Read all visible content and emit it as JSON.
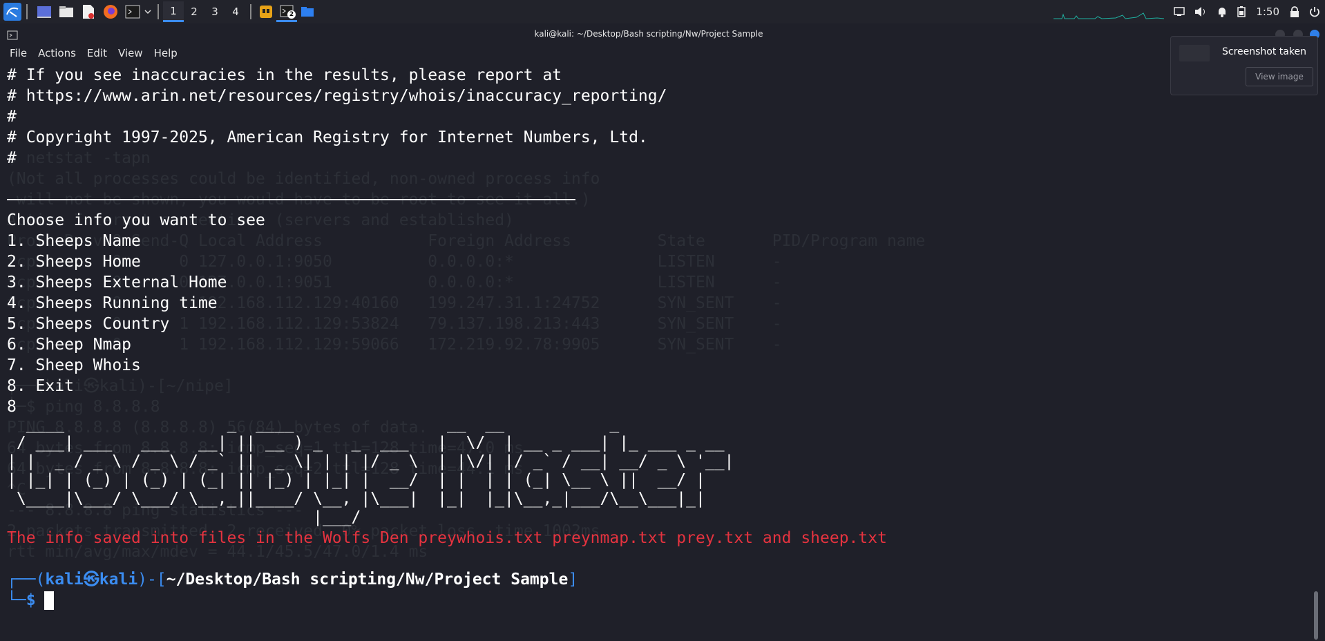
{
  "taskbar": {
    "workspaces": [
      "1",
      "2",
      "3",
      "4"
    ],
    "active_workspace": "1",
    "terminal_badge": "2",
    "clock": "1:50"
  },
  "window": {
    "title": "kali@kali: ~/Desktop/Bash scripting/Nw/Project Sample"
  },
  "menu": [
    "File",
    "Actions",
    "Edit",
    "View",
    "Help"
  ],
  "terminal": {
    "lines": [
      "# If you see inaccuracies in the results, please report at",
      "# https://www.arin.net/resources/registry/whois/inaccuracy_reporting/",
      "#",
      "# Copyright 1997-2025, American Registry for Internet Numbers, Ltd.",
      "#"
    ],
    "menu_header": "Choose info you want to see",
    "options": [
      "1. Sheeps Name",
      "2. Sheeps Home",
      "3. Sheeps External Home",
      "4. Sheeps Running time",
      "5. Sheeps Country",
      "6. Sheep Nmap",
      "7. Sheep Whois",
      "8. Exit"
    ],
    "input": "8",
    "ascii_art": [
      "  ____                 _  ____                __  __           _",
      " / ___| ___   ___   __| || __ ) _   _  ___   |  \\/  | __ _ ___| |_ ___ _ __",
      "| |  _ / _ \\ / _ \\ / _` ||  _ \\| | | |/ _ \\  | |\\/| |/ _` / __| __/ _ \\ '__|",
      "| |_| | (_) | (_) | (_| || |_) | |_| |  __/  | |  | | (_| \\__ \\ ||  __/ |",
      " \\____|\\___/ \\___/ \\__,_||____/ \\__, |\\___|  |_|  |_|\\__,_|___/\\__\\___|_|",
      "                                |___/"
    ],
    "saved_message": "The info saved into files in the Wolfs Den preywhois.txt preynmap.txt prey.txt and sheep.txt",
    "prompt": {
      "user": "kali",
      "separator": "㉿",
      "host": "kali",
      "path": "~/Desktop/Bash scripting/Nw/Project Sample",
      "symbol": "$"
    },
    "background_ghost": [
      "$ netstat -tapn",
      "(Not all processes could be identified, non-owned process info",
      " will not be shown, you would have to be root to see it all.)",
      "Active Internet connections (servers and established)",
      "Proto Recv-Q Send-Q Local Address           Foreign Address         State       PID/Program name",
      "tcp        0      0 127.0.0.1:9050          0.0.0.0:*               LISTEN      -",
      "tcp        0      0 127.0.0.1:9051          0.0.0.0:*               LISTEN      -",
      "tcp        0      1 192.168.112.129:40160   199.247.31.1:24752      SYN_SENT    -",
      "tcp        0      1 192.168.112.129:53824   79.137.198.213:443      SYN_SENT    -",
      "tcp        0      1 192.168.112.129:59066   172.219.92.78:9905      SYN_SENT    -",
      "",
      "┌──(kali㉿kali)-[~/nipe]",
      "└─$ ping 8.8.8.8",
      "PING 8.8.8.8 (8.8.8.8) 56(84) bytes of data.",
      "64 bytes from 8.8.8.8: icmp_seq=1 ttl=128 time=47.0 ms",
      "64 bytes from 8.8.8.8: icmp_seq=2 ttl=128 time=44.1 ms",
      "^C",
      "--- 8.8.8.8 ping statistics ---",
      "2 packets transmitted, 2 received, 0% packet loss, time 1002ms",
      "rtt min/avg/max/mdev = 44.1/45.5/47.0/1.4 ms"
    ]
  },
  "notification": {
    "title": "Screenshot taken",
    "button": "View image"
  },
  "colors": {
    "accent": "#3b8cf0",
    "error_red": "#e5333f",
    "background": "#1f2029"
  }
}
